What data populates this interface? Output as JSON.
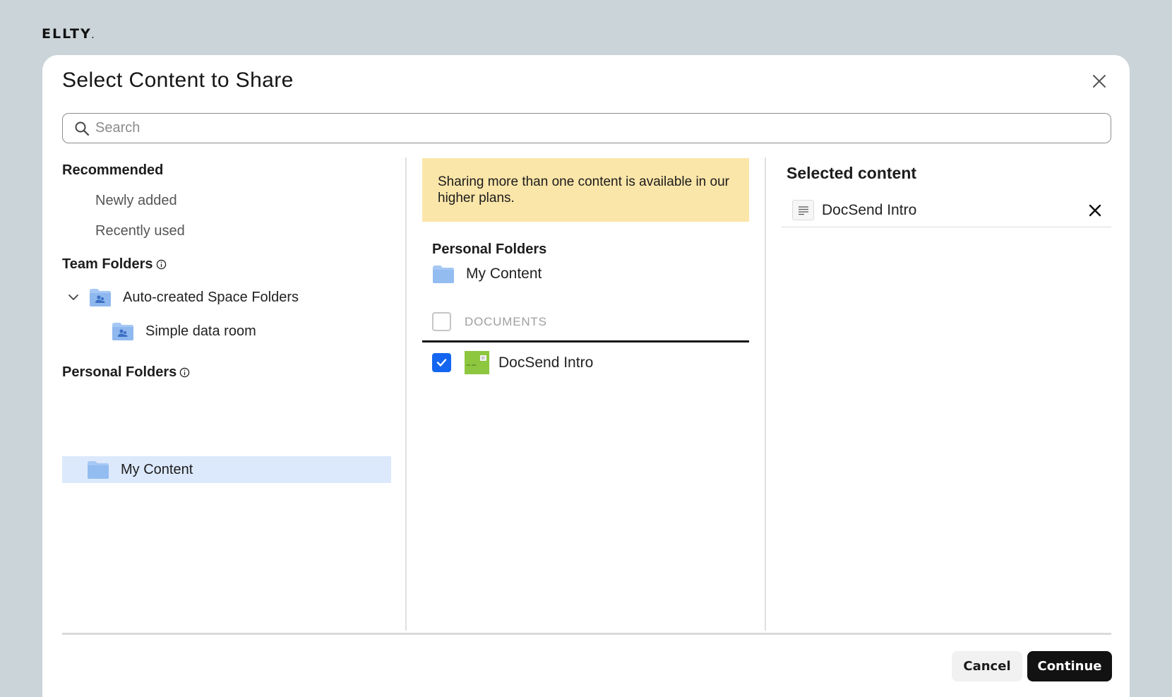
{
  "brand": {
    "name": "ELLTY",
    "mark": "."
  },
  "dialog": {
    "title": "Select Content to Share",
    "search": {
      "placeholder": "Search",
      "value": ""
    }
  },
  "left": {
    "recommended": {
      "heading": "Recommended",
      "items": [
        {
          "label": "Newly added"
        },
        {
          "label": "Recently used"
        }
      ]
    },
    "team_folders": {
      "heading": "Team Folders",
      "items": [
        {
          "label": "Auto-created Space Folders",
          "expanded": true
        },
        {
          "label": "Simple data room"
        }
      ]
    },
    "personal_folders": {
      "heading": "Personal Folders",
      "items": [
        {
          "label": "My Content",
          "selected": true
        }
      ]
    }
  },
  "middle": {
    "banner": "Sharing more than one content is available in our higher plans.",
    "folder_heading": "Personal Folders",
    "folder_label": "My Content",
    "documents_header": "DOCUMENTS",
    "documents": [
      {
        "name": "DocSend Intro",
        "checked": true
      }
    ]
  },
  "right": {
    "heading": "Selected content",
    "items": [
      {
        "name": "DocSend Intro"
      }
    ]
  },
  "footer": {
    "cancel_label": "Cancel",
    "continue_label": "Continue"
  },
  "colors": {
    "accent": "#1466f0",
    "banner": "#fbe6a9",
    "selection": "#dce9fc",
    "primary_button": "#121212",
    "backdrop": "#cbd4d8"
  }
}
